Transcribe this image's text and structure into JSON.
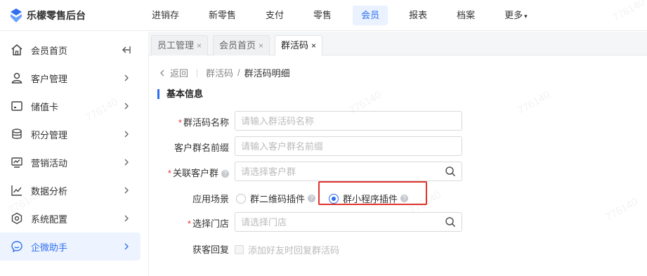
{
  "app": {
    "brand": "乐檬零售后台",
    "brand_color": "#2f6fed"
  },
  "topnav": {
    "items": [
      {
        "label": "进销存"
      },
      {
        "label": "新零售"
      },
      {
        "label": "支付"
      },
      {
        "label": "零售"
      },
      {
        "label": "会员",
        "active": true
      },
      {
        "label": "报表"
      },
      {
        "label": "档案"
      },
      {
        "label": "更多"
      }
    ],
    "more_caret": "▾"
  },
  "sidebar": {
    "collapse_icon": "collapse-left-icon",
    "items": [
      {
        "label": "会员首页",
        "icon": "home-icon"
      },
      {
        "label": "客户管理",
        "icon": "user-icon"
      },
      {
        "label": "储值卡",
        "icon": "card-icon"
      },
      {
        "label": "积分管理",
        "icon": "database-icon"
      },
      {
        "label": "营销活动",
        "icon": "monitor-chart-icon"
      },
      {
        "label": "数据分析",
        "icon": "line-chart-icon"
      },
      {
        "label": "系统配置",
        "icon": "settings-icon"
      },
      {
        "label": "企微助手",
        "icon": "chat-icon",
        "active": true
      }
    ]
  },
  "tabs": [
    {
      "label": "员工管理",
      "close": "×"
    },
    {
      "label": "会员首页",
      "close": "×"
    },
    {
      "label": "群活码",
      "close": "×",
      "active": true
    }
  ],
  "breadcrumb": {
    "back": "返回",
    "parent": "群活码",
    "sep": "/",
    "current": "群活码明细"
  },
  "section": {
    "title": "基本信息"
  },
  "form": {
    "name": {
      "label": "群活码名称",
      "required": true,
      "placeholder": "请输入群活码名称"
    },
    "prefix": {
      "label": "客户群名前缀",
      "placeholder": "请输入客户群名前缀"
    },
    "group": {
      "label": "关联客户群",
      "required": true,
      "placeholder": "请选择客户群"
    },
    "scene": {
      "label": "应用场景",
      "options": [
        {
          "label": "群二维码插件",
          "selected": false
        },
        {
          "label": "群小程序插件",
          "selected": true
        }
      ]
    },
    "store": {
      "label": "选择门店",
      "required": true,
      "placeholder": "请选择门店"
    },
    "reply": {
      "label": "获客回复",
      "checkbox_label": "添加好友时回复群活码"
    }
  },
  "required_mark": "*",
  "help_mark": "?",
  "watermark": "776140"
}
